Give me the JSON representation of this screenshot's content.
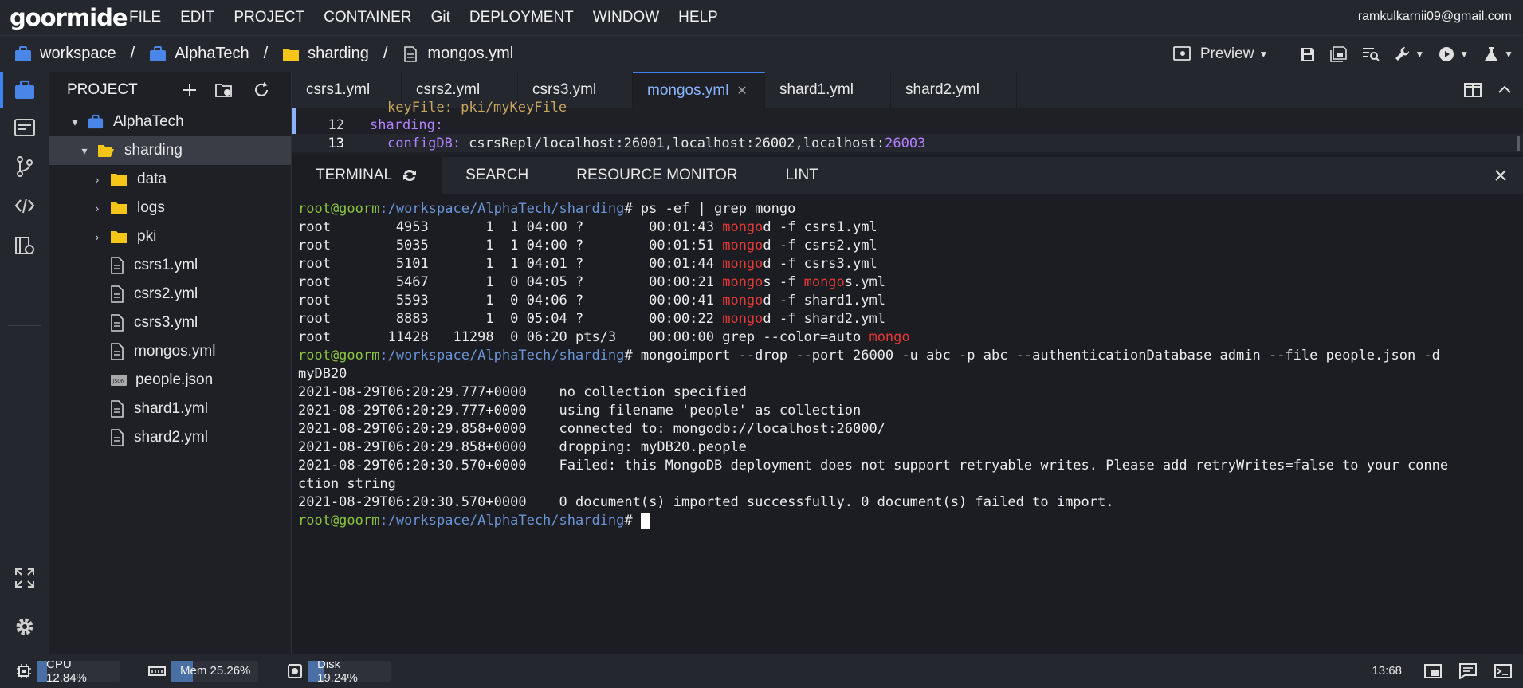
{
  "app": {
    "logo": "goormide",
    "user_email": "ramkulkarnii09@gmail.com"
  },
  "menu": [
    "FILE",
    "EDIT",
    "PROJECT",
    "CONTAINER",
    "Git",
    "DEPLOYMENT",
    "WINDOW",
    "HELP"
  ],
  "breadcrumb": [
    "workspace",
    "AlphaTech",
    "sharding",
    "mongos.yml"
  ],
  "toolbar": {
    "preview_label": "Preview"
  },
  "project": {
    "title": "PROJECT",
    "tree": [
      {
        "label": "AlphaTech",
        "type": "project",
        "level": 0,
        "expanded": true
      },
      {
        "label": "sharding",
        "type": "folder-open",
        "level": 1,
        "expanded": true,
        "selected": true
      },
      {
        "label": "data",
        "type": "folder",
        "level": 2
      },
      {
        "label": "logs",
        "type": "folder",
        "level": 2
      },
      {
        "label": "pki",
        "type": "folder",
        "level": 2
      },
      {
        "label": "csrs1.yml",
        "type": "file",
        "level": 2
      },
      {
        "label": "csrs2.yml",
        "type": "file",
        "level": 2
      },
      {
        "label": "csrs3.yml",
        "type": "file",
        "level": 2
      },
      {
        "label": "mongos.yml",
        "type": "file",
        "level": 2
      },
      {
        "label": "people.json",
        "type": "json",
        "level": 2
      },
      {
        "label": "shard1.yml",
        "type": "file",
        "level": 2
      },
      {
        "label": "shard2.yml",
        "type": "file",
        "level": 2
      }
    ]
  },
  "editor_tabs": [
    {
      "label": "csrs1.yml",
      "active": false
    },
    {
      "label": "csrs2.yml",
      "active": false
    },
    {
      "label": "csrs3.yml",
      "active": false
    },
    {
      "label": "mongos.yml",
      "active": true
    },
    {
      "label": "shard1.yml",
      "active": false
    },
    {
      "label": "shard2.yml",
      "active": false
    }
  ],
  "code": {
    "partial_line": "keyFile: pki/myKeyFile",
    "line12": {
      "num": "12",
      "key": "sharding:"
    },
    "line13": {
      "num": "13",
      "key": "configDB:",
      "value": "csrsRepl/localhost:26001,localhost:26002,localhost:",
      "port": "26003"
    }
  },
  "panel_tabs": [
    "TERMINAL",
    "SEARCH",
    "RESOURCE MONITOR",
    "LINT"
  ],
  "terminal": {
    "prompt_user": "root@goorm",
    "prompt_path": ":/workspace/AlphaTech/sharding",
    "cmd1": "# ps -ef | grep mongo",
    "ps_rows": [
      {
        "pre": "root        4953       1  1 04:00 ?        00:01:43 ",
        "m1": "mongo",
        "mid": "d -f csrs1.yml",
        "m2": "",
        "post": ""
      },
      {
        "pre": "root        5035       1  1 04:00 ?        00:01:51 ",
        "m1": "mongo",
        "mid": "d -f csrs2.yml",
        "m2": "",
        "post": ""
      },
      {
        "pre": "root        5101       1  1 04:01 ?        00:01:44 ",
        "m1": "mongo",
        "mid": "d -f csrs3.yml",
        "m2": "",
        "post": ""
      },
      {
        "pre": "root        5467       1  0 04:05 ?        00:00:21 ",
        "m1": "mongo",
        "mid": "s -f ",
        "m2": "mongo",
        "post": "s.yml"
      },
      {
        "pre": "root        5593       1  0 04:06 ?        00:00:41 ",
        "m1": "mongo",
        "mid": "d -f shard1.yml",
        "m2": "",
        "post": ""
      },
      {
        "pre": "root        8883       1  0 05:04 ?        00:00:22 ",
        "m1": "mongo",
        "mid": "d -f shard2.yml",
        "m2": "",
        "post": ""
      },
      {
        "pre": "root       11428   11298  0 06:20 pts/3    00:00:00 grep --color=auto ",
        "m1": "mongo",
        "mid": "",
        "m2": "",
        "post": ""
      }
    ],
    "cmd2": "# mongoimport --drop --port 26000 -u abc -p abc --authenticationDatabase admin --file people.json -d",
    "cmd2_wrap": "myDB20",
    "log_lines": [
      "2021-08-29T06:20:29.777+0000    no collection specified",
      "2021-08-29T06:20:29.777+0000    using filename 'people' as collection",
      "2021-08-29T06:20:29.858+0000    connected to: mongodb://localhost:26000/",
      "2021-08-29T06:20:29.858+0000    dropping: myDB20.people",
      "2021-08-29T06:20:30.570+0000    Failed: this MongoDB deployment does not support retryable writes. Please add retryWrites=false to your conne",
      "ction string",
      "2021-08-29T06:20:30.570+0000    0 document(s) imported successfully. 0 document(s) failed to import."
    ],
    "cmd3": "# "
  },
  "status": {
    "cpu": {
      "label": "CPU 12.84%",
      "percent": 12.84
    },
    "mem": {
      "label": "Mem 25.26%",
      "percent": 25.26
    },
    "disk": {
      "label": "Disk 19.24%",
      "percent": 19.24
    },
    "cursor_pos": "13:68"
  },
  "colors": {
    "accent": "#3d82f0",
    "prompt_user": "#8ac43f",
    "prompt_path": "#6b95d6",
    "match": "#e53935",
    "folder": "#f5c518",
    "project_icon": "#4a86e8"
  }
}
